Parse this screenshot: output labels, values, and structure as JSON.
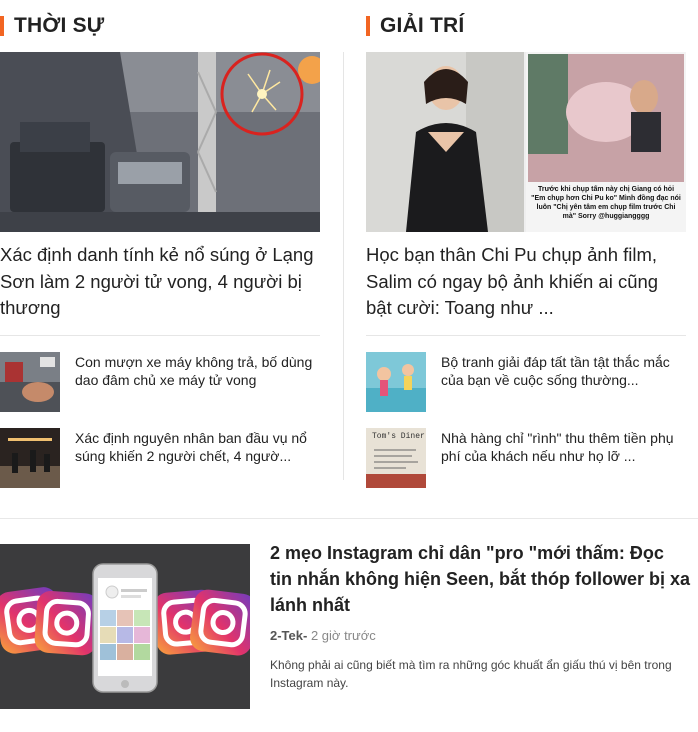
{
  "sections": [
    {
      "title": "THỜI SỰ",
      "lead": {
        "title": "Xác định danh tính kẻ nổ súng ở Lạng Sơn làm 2 người tử vong, 4 người bị thương"
      },
      "items": [
        {
          "title": "Con mượn xe máy không trả, bố dùng dao đâm chủ xe máy tử vong"
        },
        {
          "title": "Xác định nguyên nhân ban đầu vụ nổ súng khiến 2 người chết, 4 ngườ..."
        }
      ]
    },
    {
      "title": "GIẢI TRÍ",
      "lead": {
        "title": "Học bạn thân Chi Pu chụp ảnh film, Salim có ngay bộ ảnh khiến ai cũng bật cười: Toang như ...",
        "image_caption": "Trước khi chụp tấm này chị Giang có hỏi \"Em chụp hơn Chi Pu ko\" Mình đồng đạc nói luôn \"Chị yên tâm em chụp film trước Chi mà\" Sorry @huggiangggg"
      },
      "items": [
        {
          "title": "Bộ tranh giải đáp tất tần tật thắc mắc của bạn về cuộc sống thường..."
        },
        {
          "title": "Nhà hàng chỉ \"rình\" thu thêm tiền phụ phí của khách nếu như họ lỡ ...",
          "thumb_text": "Tom's Diner"
        }
      ]
    }
  ],
  "feature": {
    "title": "2 mẹo Instagram chỉ dân \"pro \"mới thấm: Đọc tin nhắn không hiện Seen, bắt thóp follower bị xa lánh nhất",
    "source": "2-Tek",
    "separator": "-",
    "time": "2 giờ trước",
    "sapo": "Không phải ai cũng biết mà tìm ra những góc khuất ẩn giấu thú vị bên trong Instagram này."
  },
  "colors": {
    "accent": "#f26522",
    "text": "#222222",
    "meta": "#888888"
  },
  "icons": [
    "instagram-logo-icon"
  ]
}
